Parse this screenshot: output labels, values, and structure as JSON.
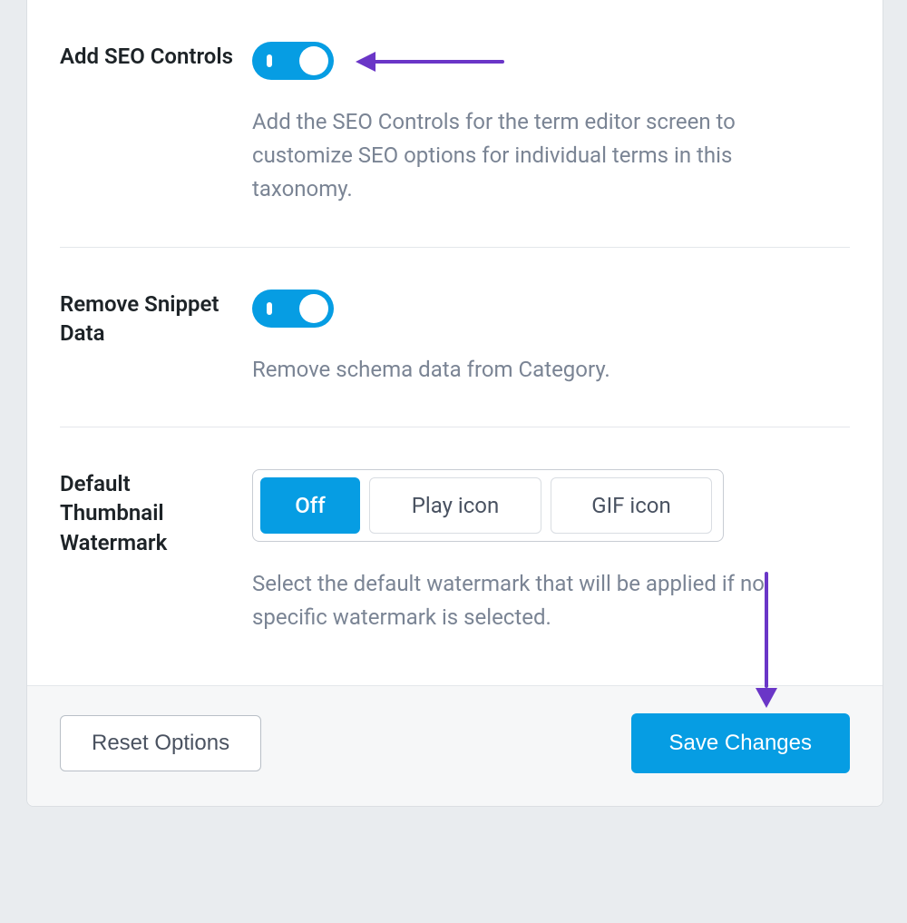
{
  "settings": {
    "add_seo": {
      "label": "Add SEO Controls",
      "description": "Add the SEO Controls for the term editor screen to customize SEO options for individual terms in this taxonomy.",
      "enabled": true
    },
    "remove_snippet": {
      "label": "Remove Snippet Data",
      "description": "Remove schema data from Category.",
      "enabled": true
    },
    "watermark": {
      "label": "Default Thumbnail Watermark",
      "description": "Select the default watermark that will be applied if no specific watermark is selected.",
      "options": {
        "off": "Off",
        "play": "Play icon",
        "gif": "GIF icon"
      },
      "selected": "off"
    }
  },
  "footer": {
    "reset": "Reset Options",
    "save": "Save Changes"
  },
  "colors": {
    "accent": "#069de3",
    "annotation": "#6a36c7"
  }
}
